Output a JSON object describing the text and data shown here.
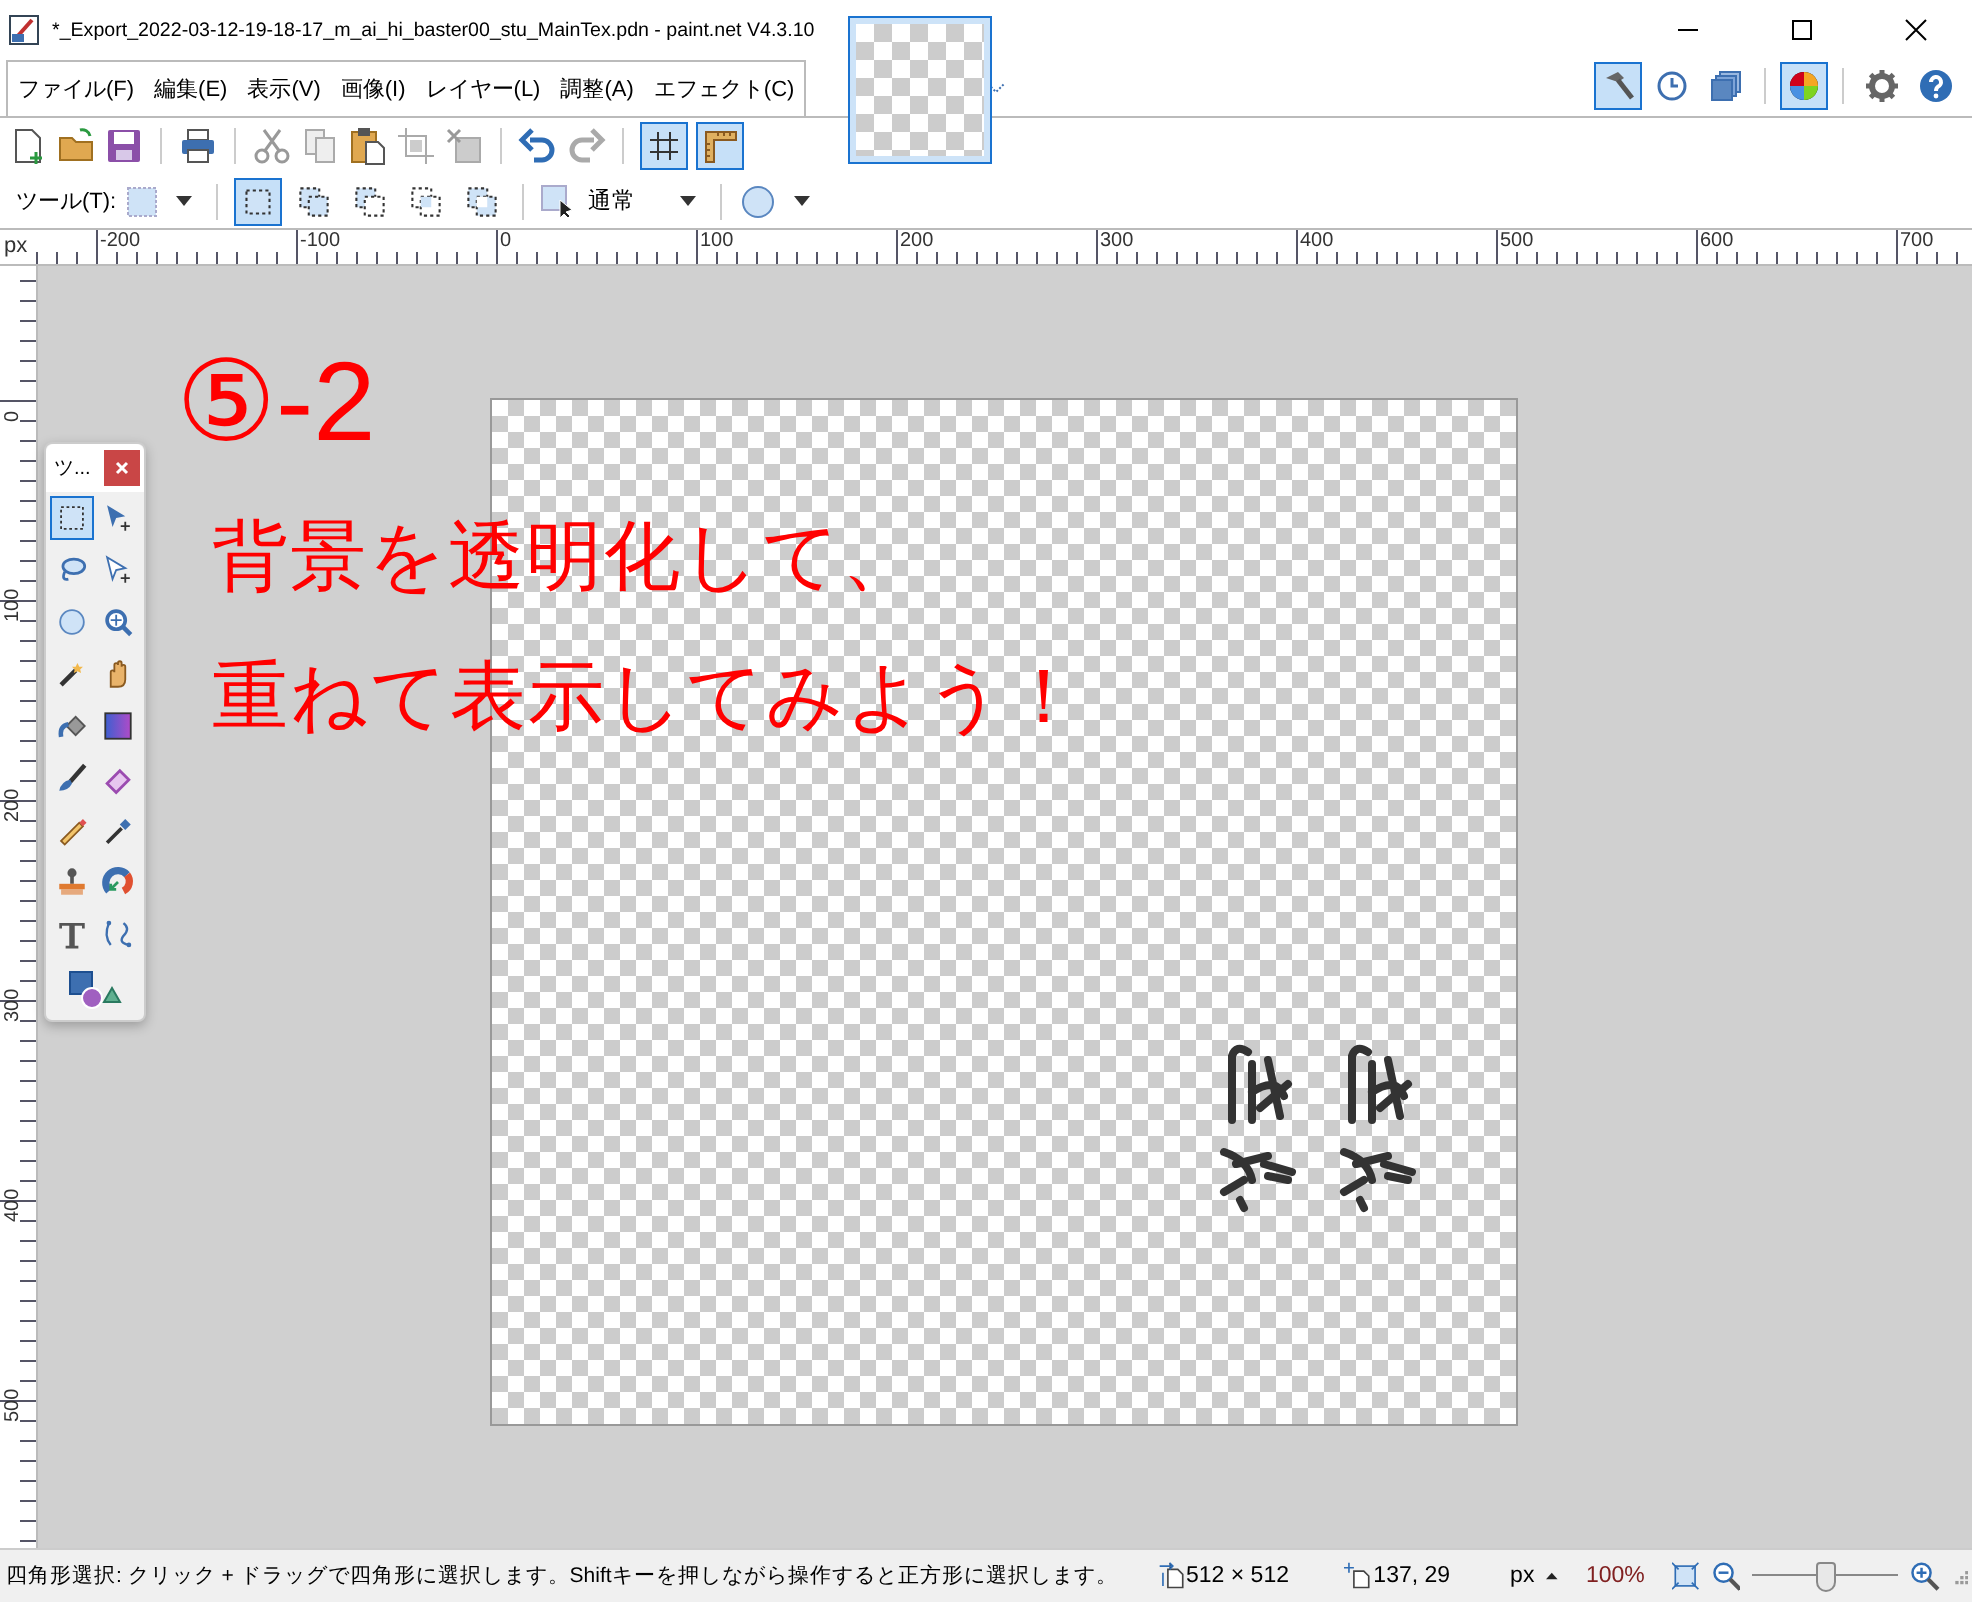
{
  "window": {
    "title": "*_Export_2022-03-12-19-18-17_m_ai_hi_baster00_stu_MainTex.pdn - paint.net V4.3.10"
  },
  "menu": [
    "ファイル(F)",
    "編集(E)",
    "表示(V)",
    "画像(I)",
    "レイヤー(L)",
    "調整(A)",
    "エフェクト(C)"
  ],
  "view_toggles": [
    {
      "kind": "grid",
      "selected": true
    },
    {
      "kind": "ruler",
      "selected": true
    }
  ],
  "window_toggles": [
    {
      "kind": "tools",
      "selected": true
    },
    {
      "kind": "history",
      "selected": false
    },
    {
      "kind": "layers",
      "selected": false
    },
    {
      "kind": "colors",
      "selected": true
    }
  ],
  "tool_options": {
    "label": "ツール(T):",
    "selection_modes": [
      {
        "kind": "replace",
        "selected": true
      },
      {
        "kind": "union",
        "selected": false
      },
      {
        "kind": "exclude",
        "selected": false
      },
      {
        "kind": "intersect",
        "selected": false
      },
      {
        "kind": "invert",
        "selected": false
      }
    ],
    "blend_mode": "通常"
  },
  "rulers": {
    "unit": "px",
    "top_labels": [
      "-200",
      "-100",
      "0",
      "100",
      "200",
      "300",
      "400",
      "500",
      "600",
      "700"
    ],
    "left_labels": [
      "0",
      "100",
      "200",
      "300",
      "400",
      "500"
    ]
  },
  "overlay": {
    "step": "⑤-2",
    "lines": [
      "背景を透明化して、",
      "重ねて表示してみよう！"
    ]
  },
  "tools_window": {
    "title": "ツ...",
    "tools": [
      {
        "kind": "rectangle-select",
        "selected": true
      },
      {
        "kind": "move-pixels",
        "selected": false
      },
      {
        "kind": "lasso",
        "selected": false
      },
      {
        "kind": "move-selection",
        "selected": false
      },
      {
        "kind": "ellipse-select",
        "selected": false
      },
      {
        "kind": "zoom",
        "selected": false
      },
      {
        "kind": "magic-wand",
        "selected": false
      },
      {
        "kind": "pan",
        "selected": false
      },
      {
        "kind": "bucket",
        "selected": false
      },
      {
        "kind": "gradient",
        "selected": false
      },
      {
        "kind": "brush",
        "selected": false
      },
      {
        "kind": "eraser",
        "selected": false
      },
      {
        "kind": "pencil",
        "selected": false
      },
      {
        "kind": "picker",
        "selected": false
      },
      {
        "kind": "stamp",
        "selected": false
      },
      {
        "kind": "recolor",
        "selected": false
      },
      {
        "kind": "text",
        "selected": false
      },
      {
        "kind": "curve",
        "selected": false
      },
      {
        "kind": "shapes",
        "selected": false
      }
    ]
  },
  "status_bar": {
    "hint": "四角形選択: クリック + ドラッグで四角形に選択します。Shiftキーを押しながら操作すると正方形に選択します。",
    "image_size": "512 × 512",
    "cursor": "137, 29",
    "unit": "px",
    "zoom": "100%",
    "zoom_slider": {
      "level": 0.5
    }
  }
}
